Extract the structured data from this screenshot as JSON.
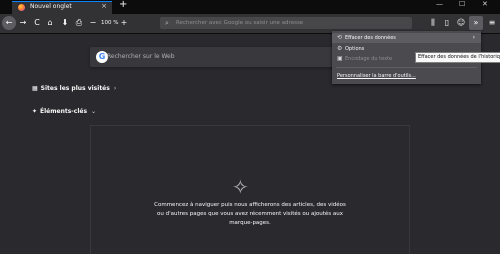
{
  "window": {
    "tab_title": "Nouvel onglet",
    "tab_close": "×",
    "new_tab": "+",
    "minimize": "—",
    "maximize": "☐",
    "close": "✕"
  },
  "toolbar": {
    "back": "←",
    "forward": "→",
    "reload": "C",
    "home": "⌂",
    "save": "⬇",
    "print": "⎙",
    "zoom_out": "−",
    "zoom_level": "100 %",
    "zoom_in": "+",
    "search_placeholder": "Rechercher avec Google ou saisir une adresse",
    "library": "⫼",
    "sidebar": "▯",
    "account": "☺",
    "extensions": "⚙",
    "overflow": "»",
    "menu": "≡"
  },
  "overflow_menu": {
    "items": [
      {
        "icon": "⟲",
        "label": "Effacer des données",
        "arrow": "›"
      },
      {
        "icon": "⚙",
        "label": "Options"
      },
      {
        "icon": "▣",
        "label": "Encodage du texte"
      },
      {
        "label": "Personnaliser la barre d'outils..."
      }
    ],
    "tooltip": "Effacer des données de l'historique"
  },
  "newtab": {
    "search_placeholder": "Rechercher sur le Web",
    "google_letter": "G",
    "top_sites": {
      "label": "Sites les plus visités",
      "icon": "▦",
      "chevron": "›"
    },
    "highlights": {
      "label": "Éléments-clés",
      "icon": "✦",
      "chevron": "⌄"
    },
    "empty_icon": "✧",
    "empty_message": "Commencez à naviguer puis nous afficherons des articles, des vidéos ou d'autres pages que vous avez récemment visités ou ajoutés aux marque-pages."
  }
}
